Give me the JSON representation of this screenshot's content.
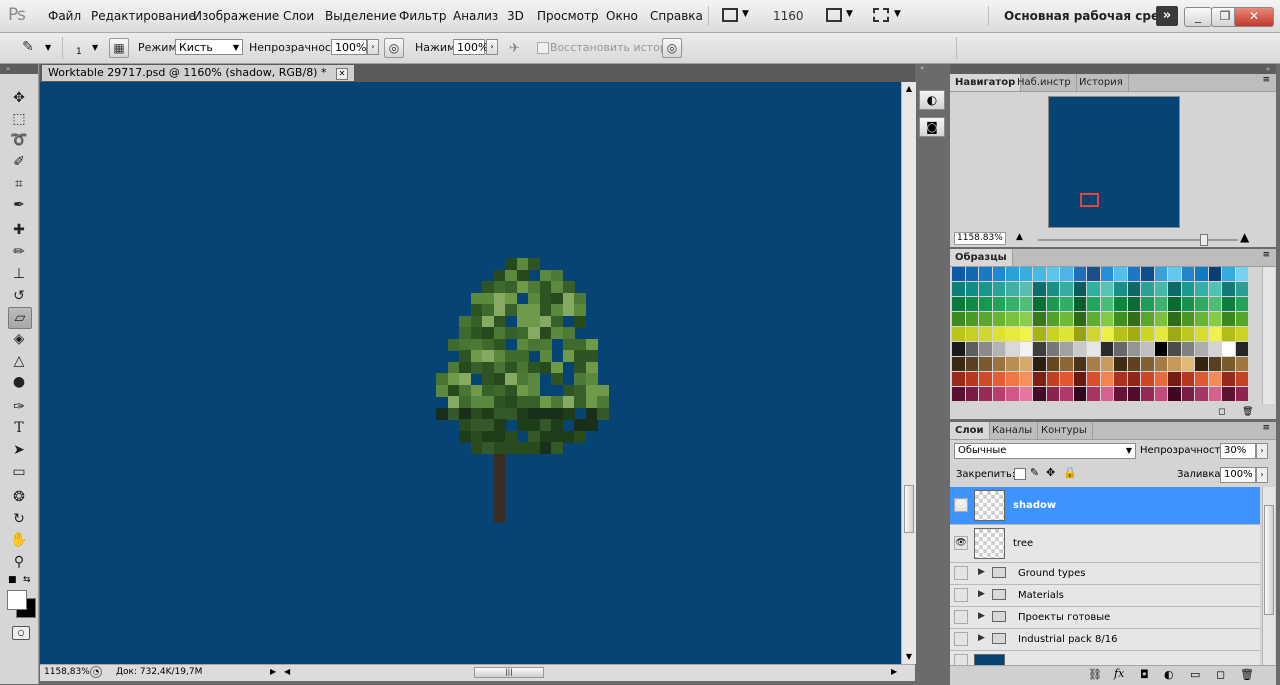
{
  "app": {
    "logo": "Ps",
    "workspace": "Основная рабочая среда"
  },
  "menu": [
    "Файл",
    "Редактирование",
    "Изображение",
    "Слои",
    "Выделение",
    "Фильтр",
    "Анализ",
    "3D",
    "Просмотр",
    "Окно",
    "Справка"
  ],
  "menubar_zoom": "1160",
  "options": {
    "brush_size": "1",
    "mode_label": "Режим:",
    "mode_value": "Кисть",
    "opacity_label": "Непрозрачность:",
    "opacity_value": "100%",
    "flow_label": "Нажим:",
    "flow_value": "100%",
    "erase_history_label": "Восстановить историю"
  },
  "document": {
    "tab_title": "Worktable 29717.psd @ 1160% (shadow, RGB/8) *",
    "canvas_color": "#064476",
    "zoom": "1158,83%",
    "doc_info": "Док: 732,4K/19,7M"
  },
  "navigator": {
    "tabs": [
      "Навигатор",
      "Наб.инстр",
      "История"
    ],
    "zoom": "1158.83%"
  },
  "swatches": {
    "title": "Образцы"
  },
  "layers": {
    "tabs": [
      "Слои",
      "Каналы",
      "Контуры"
    ],
    "blend_mode": "Обычные",
    "opacity_label": "Непрозрачность:",
    "opacity_value": "30%",
    "lock_label": "Закрепить:",
    "fill_label": "Заливка:",
    "fill_value": "100%",
    "items": [
      {
        "name": "shadow",
        "type": "layer",
        "visible": true,
        "selected": true
      },
      {
        "name": "tree",
        "type": "layer",
        "visible": true,
        "selected": false
      },
      {
        "name": "Ground types",
        "type": "group",
        "visible": false,
        "selected": false
      },
      {
        "name": "Materials",
        "type": "group",
        "visible": false,
        "selected": false
      },
      {
        "name": "Проекты готовые",
        "type": "group",
        "visible": false,
        "selected": false
      },
      {
        "name": "Industrial pack 8/16",
        "type": "group",
        "visible": false,
        "selected": false
      }
    ]
  },
  "colors": {
    "accent": "#3d93ff",
    "canvas": "#064476"
  }
}
